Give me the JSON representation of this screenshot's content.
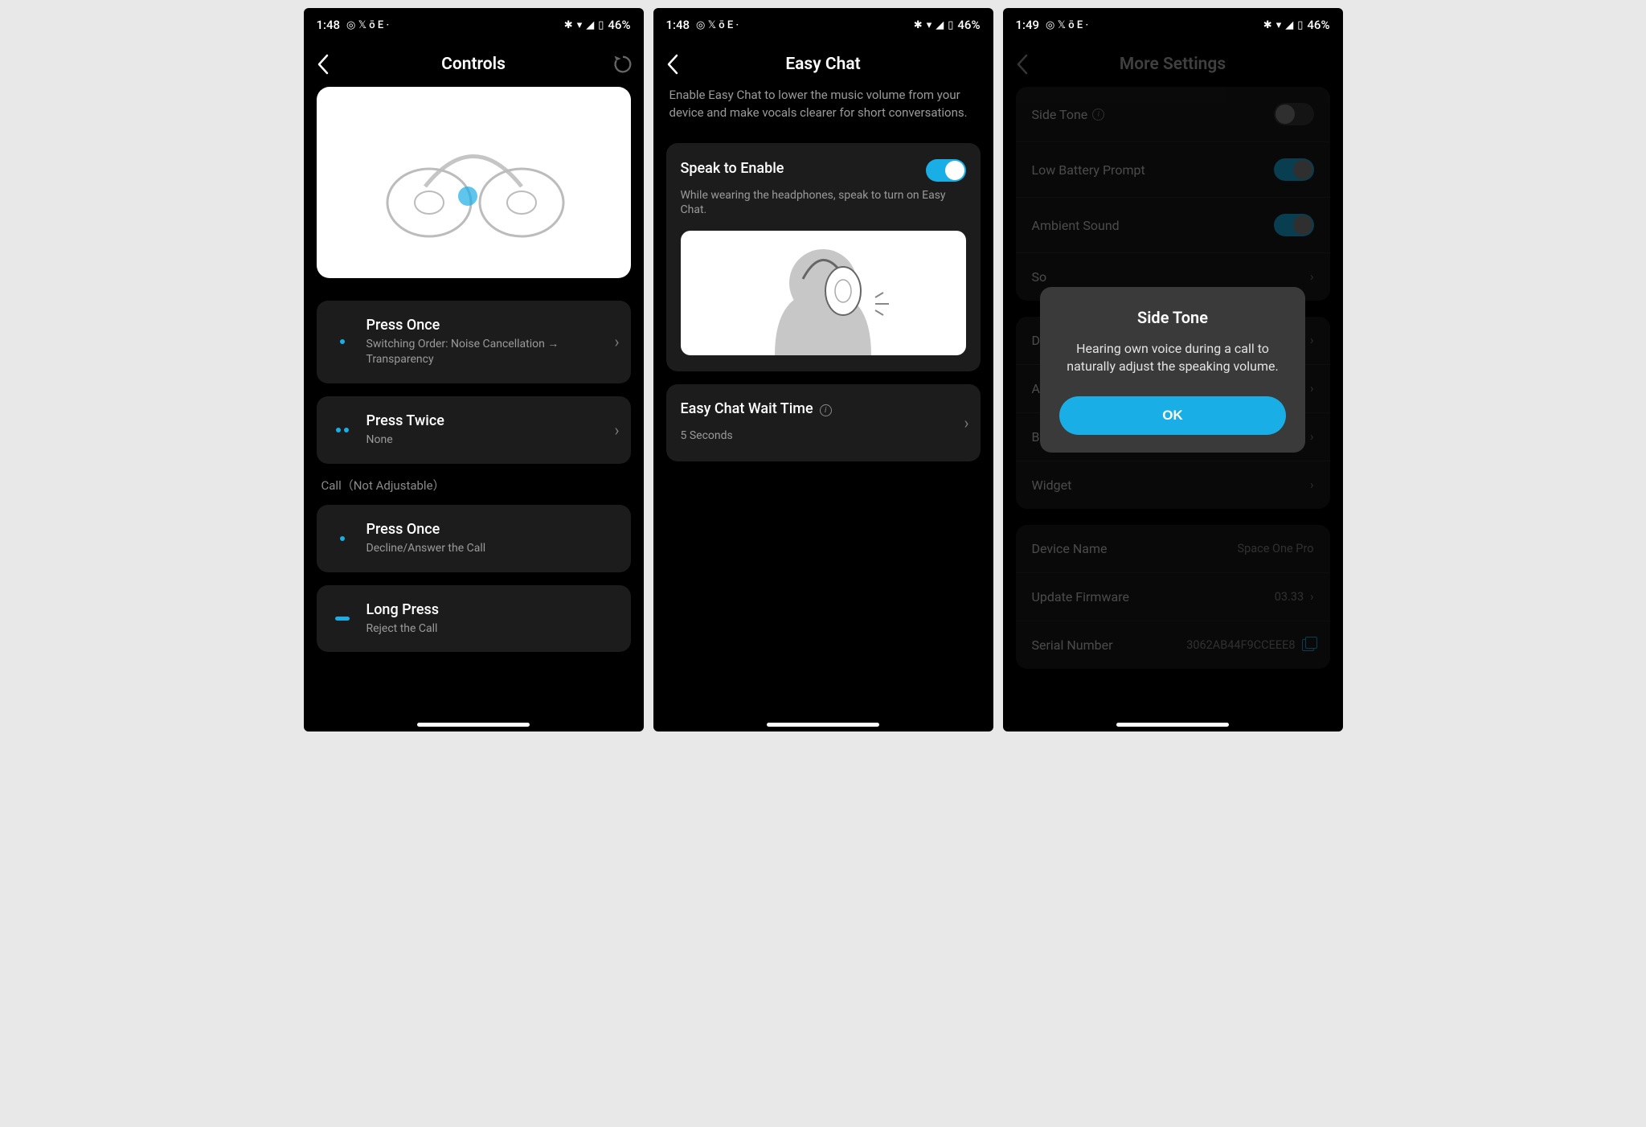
{
  "status": {
    "time1": "1:48",
    "time2": "1:48",
    "time3": "1:49",
    "icons_left": "◎ 𝕏 ō E  ·",
    "battery_text": "46%"
  },
  "screen1": {
    "title": "Controls",
    "items": [
      {
        "title": "Press Once",
        "sub": "Switching Order: Noise Cancellation → Transparency"
      },
      {
        "title": "Press Twice",
        "sub": "None"
      }
    ],
    "call_section_label": "Call（Not Adjustable）",
    "call_items": [
      {
        "title": "Press Once",
        "sub": "Decline/Answer the Call"
      },
      {
        "title": "Long Press",
        "sub": "Reject the Call"
      }
    ]
  },
  "screen2": {
    "title": "Easy Chat",
    "description": "Enable Easy Chat to lower the music volume from your device and make vocals clearer for short conversations.",
    "speak": {
      "title": "Speak to Enable",
      "sub": "While wearing the headphones, speak to turn on Easy Chat.",
      "enabled": true
    },
    "wait": {
      "title": "Easy Chat Wait Time",
      "value": "5 Seconds"
    }
  },
  "screen3": {
    "title": "More Settings",
    "rows1": [
      {
        "label": "Side Tone",
        "type": "toggle",
        "on": false,
        "info": true
      },
      {
        "label": "Low Battery Prompt",
        "type": "toggle",
        "on": true
      },
      {
        "label": "Ambient Sound",
        "type": "toggle",
        "on": true
      },
      {
        "label": "So",
        "type": "nav"
      }
    ],
    "rows2": [
      {
        "label": "D",
        "type": "nav"
      },
      {
        "label": "A",
        "type": "nav"
      },
      {
        "label": "Be",
        "type": "nav"
      },
      {
        "label": "Widget",
        "type": "nav"
      }
    ],
    "rows3": [
      {
        "label": "Device Name",
        "value": "Space One Pro",
        "type": "value"
      },
      {
        "label": "Update Firmware",
        "value": "03.33",
        "type": "nav-value"
      },
      {
        "label": "Serial Number",
        "value": "3062AB44F9CCEEE8",
        "type": "copy"
      }
    ],
    "modal": {
      "title": "Side Tone",
      "body": "Hearing own voice during a call to naturally adjust the speaking volume.",
      "ok": "OK"
    }
  }
}
